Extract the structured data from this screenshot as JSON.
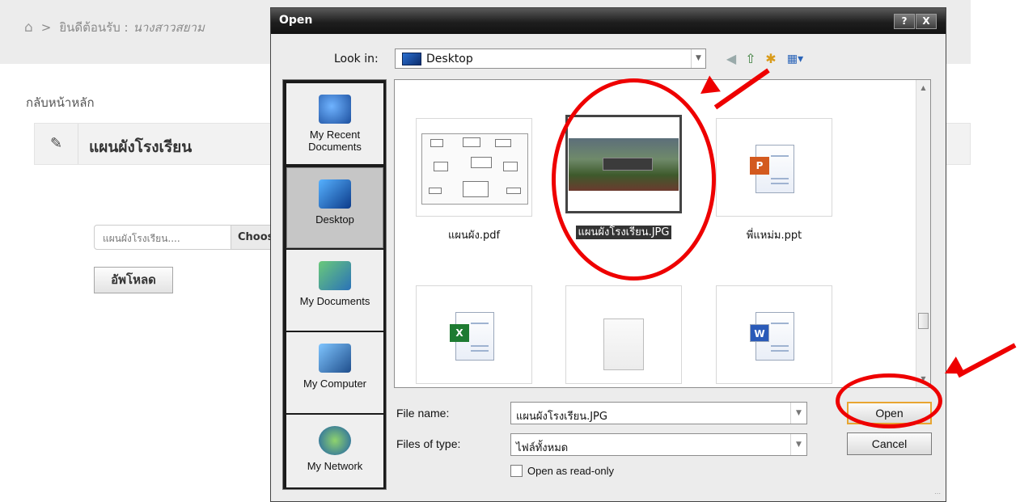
{
  "page": {
    "breadcrumb": {
      "home_icon": "home-icon",
      "separator": ">",
      "welcome": "ยินดีต้อนรับ :",
      "user": "นางสาวสยาม"
    },
    "back_link": "กลับหน้าหลัก",
    "section": {
      "icon": "edit-icon",
      "title": "แผนผังโรงเรียน"
    },
    "file_input": {
      "filename": "แผนผังโรงเรียน....",
      "choose_label": "Choos"
    },
    "upload_label": "อัพโหลด"
  },
  "dialog": {
    "title": "Open",
    "help_label": "?",
    "close_label": "X",
    "look_in_label": "Look in:",
    "look_in_value": "Desktop",
    "places": [
      {
        "label": "My Recent Documents"
      },
      {
        "label": "Desktop"
      },
      {
        "label": "My Documents"
      },
      {
        "label": "My Computer"
      },
      {
        "label": "My Network"
      }
    ],
    "files": [
      {
        "name": "แผนผัง.pdf",
        "type": "pdf"
      },
      {
        "name": "แผนผังโรงเรียน.JPG",
        "type": "jpg",
        "selected": true
      },
      {
        "name": "พี่แหม่ม.ppt",
        "type": "ppt"
      },
      {
        "name": "",
        "type": "xls"
      },
      {
        "name": "",
        "type": "blank"
      },
      {
        "name": "",
        "type": "doc"
      }
    ],
    "file_name_label": "File name:",
    "file_name_value": "แผนผังโรงเรียน.JPG",
    "files_of_type_label": "Files of type:",
    "files_of_type_value": "ไฟล์ทั้งหมด",
    "read_only_label": "Open as read-only",
    "open_label": "Open",
    "cancel_label": "Cancel"
  },
  "colors": {
    "annotation": "#ee0000",
    "open_focus": "#e8a531",
    "titlebar": "#1e1e1e"
  }
}
